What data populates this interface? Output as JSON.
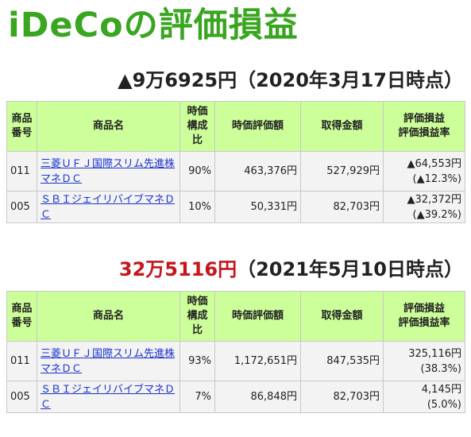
{
  "title": "iDeCoの評価損益",
  "headers": {
    "code": "商品番号",
    "name": "商品名",
    "ratio": "時価構成比",
    "market": "時価評価額",
    "cost": "取得金額",
    "gain": "評価損益評価損益率"
  },
  "section1": {
    "amount": "▲9万6925円",
    "date": "（2020年3月17日時点）",
    "rows": [
      {
        "code": "011",
        "name": "三菱ＵＦＪ国際スリム先進株マネＤＣ",
        "ratio": "90%",
        "market": "463,376円",
        "cost": "527,929円",
        "gain": "▲64,553円",
        "rate": "(▲12.3%)"
      },
      {
        "code": "005",
        "name": "ＳＢＩジェイリバイブマネＤＣ",
        "ratio": "10%",
        "market": "50,331円",
        "cost": "82,703円",
        "gain": "▲32,372円",
        "rate": "(▲39.2%)"
      }
    ]
  },
  "section2": {
    "amount": "32万5116円",
    "date": "（2021年5月10日時点）",
    "rows": [
      {
        "code": "011",
        "name": "三菱ＵＦＪ国際スリム先進株マネＤＣ",
        "ratio": "93%",
        "market": "1,172,651円",
        "cost": "847,535円",
        "gain": "325,116円",
        "rate": "(38.3%)"
      },
      {
        "code": "005",
        "name": "ＳＢＩジェイリバイブマネＤＣ",
        "ratio": "7%",
        "market": "86,848円",
        "cost": "82,703円",
        "gain": "4,145円",
        "rate": "(5.0%)"
      }
    ]
  },
  "colors": {
    "title": "#3aa520",
    "header_bg": "#ccff99",
    "positive_amount": "#c4161c",
    "link": "#1a33cc"
  }
}
